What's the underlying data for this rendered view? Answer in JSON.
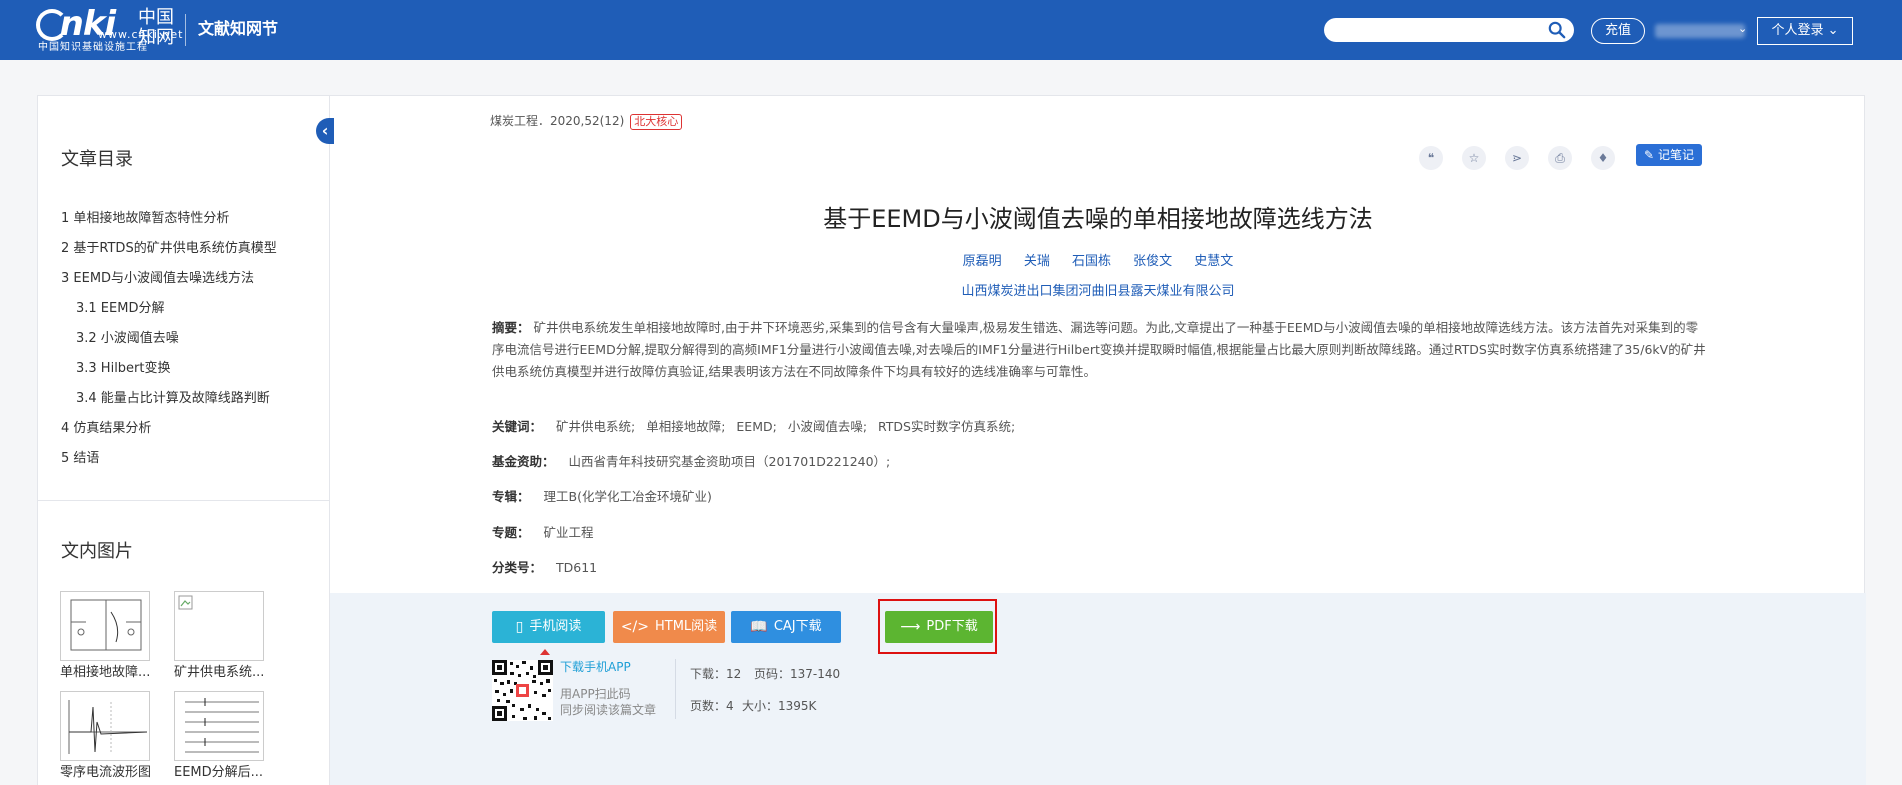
{
  "header": {
    "logo_text": "cnki.net",
    "logo_cn": "中国知网",
    "logo_url": "www.cnki.net",
    "logo_sub": "中国知识基础设施工程",
    "site_name": "文献知网节",
    "search_placeholder": "",
    "charge_label": "充值",
    "login_label": "个人登录",
    "brand_color": "#1f5db7"
  },
  "sidebar": {
    "toc_heading": "文章目录",
    "toc": [
      {
        "label": "1 单相接地故障暂态特性分析",
        "level": 1
      },
      {
        "label": "2 基于RTDS的矿井供电系统仿真模型",
        "level": 1
      },
      {
        "label": "3 EEMD与小波阈值去噪选线方法",
        "level": 1
      },
      {
        "label": "3.1 EEMD分解",
        "level": 2
      },
      {
        "label": "3.2 小波阈值去噪",
        "level": 2
      },
      {
        "label": "3.3 Hilbert变换",
        "level": 2
      },
      {
        "label": "3.4 能量占比计算及故障线路判断",
        "level": 2
      },
      {
        "label": "4 仿真结果分析",
        "level": 1
      },
      {
        "label": "5 结语",
        "level": 1
      }
    ],
    "figures_heading": "文内图片",
    "figures": [
      {
        "caption": "单相接地故障..."
      },
      {
        "caption": "矿井供电系统..."
      },
      {
        "caption": "零序电流波形图"
      },
      {
        "caption": "EEMD分解后..."
      }
    ]
  },
  "article": {
    "source": "煤炭工程．2020,52(12)",
    "source_tag": "北大核心",
    "note_button": "记笔记",
    "tool_icons": [
      "quote-icon",
      "star-icon",
      "share-icon",
      "print-icon",
      "bell-icon"
    ],
    "title": "基于EEMD与小波阈值去噪的单相接地故障选线方法",
    "authors": [
      "原磊明",
      "关瑞",
      "石国栋",
      "张俊文",
      "史慧文"
    ],
    "affiliation": "山西煤炭进出口集团河曲旧县露天煤业有限公司",
    "abstract_label": "摘要：",
    "abstract": "矿井供电系统发生单相接地故障时,由于井下环境恶劣,采集到的信号含有大量噪声,极易发生错选、漏选等问题。为此,文章提出了一种基于EEMD与小波阈值去噪的单相接地故障选线方法。该方法首先对采集到的零序电流信号进行EEMD分解,提取分解得到的高频IMF1分量进行小波阈值去噪,对去噪后的IMF1分量进行Hilbert变换并提取瞬时幅值,根据能量占比最大原则判断故障线路。通过RTDS实时数字仿真系统搭建了35/6kV的矿井供电系统仿真模型并进行故障仿真验证,结果表明该方法在不同故障条件下均具有较好的选线准确率与可靠性。",
    "keywords_label": "关键词：",
    "keywords": [
      "矿井供电系统;",
      "单相接地故障;",
      "EEMD;",
      "小波阈值去噪;",
      "RTDS实时数字仿真系统;"
    ],
    "fund_label": "基金资助：",
    "fund": "山西省青年科技研究基金资助项目（201701D221240）;",
    "series_label": "专辑：",
    "series": "理工B(化学化工冶金环境矿业)",
    "topic_label": "专题：",
    "topic": "矿业工程",
    "class_label": "分类号：",
    "class_no": "TD611"
  },
  "downloads": {
    "buttons": [
      {
        "label": "手机阅读",
        "color": "#2bb3d6"
      },
      {
        "label": "HTML阅读",
        "color": "#f08a4b"
      },
      {
        "label": "CAJ下载",
        "color": "#2f8fe0"
      },
      {
        "label": "PDF下载",
        "color": "#5cb531"
      }
    ],
    "app_link": "下载手机APP",
    "app_line1": "用APP扫此码",
    "app_line2": "同步阅读该篇文章",
    "downloads_label": "下载：",
    "downloads_value": "12",
    "pages_label": "页码：",
    "pages_value": "137-140",
    "page_count_label": "页数：",
    "page_count_value": "4",
    "size_label": "大小：",
    "size_value": "1395K"
  }
}
